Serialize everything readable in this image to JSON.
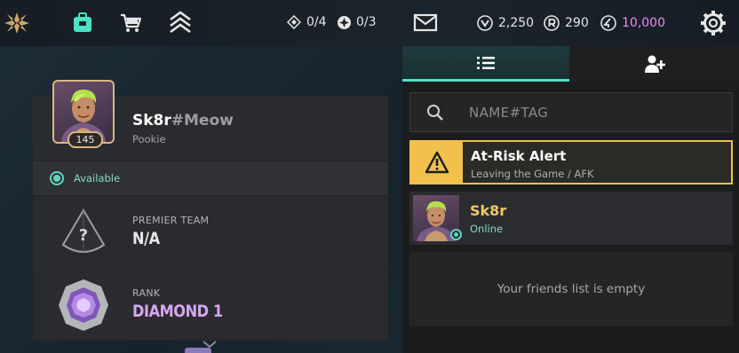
{
  "topbar": {
    "nav_icons": [
      "valorant-logo-icon",
      "collection-icon",
      "store-icon",
      "battlepass-icon"
    ],
    "counter_a": {
      "icon": "diamond-outline-icon",
      "value": "0/4"
    },
    "counter_b": {
      "icon": "star-circle-icon",
      "value": "0/3"
    },
    "mail_icon": "mail-icon",
    "kingdom_credits": {
      "icon": "kingdom-credits-icon",
      "value": "2,250"
    },
    "radianite": {
      "icon": "radianite-icon",
      "value": "290"
    },
    "valorant_points": {
      "icon": "valorant-points-icon",
      "value": "10,000"
    },
    "settings_icon": "gear-icon",
    "colors": {
      "accent_teal": "#4de0c4",
      "vp_pink": "#e98cf2"
    }
  },
  "profile": {
    "level": "145",
    "name": "Sk8r",
    "tag": "#Meow",
    "title": "Pookie",
    "status": "Available",
    "premier": {
      "label": "PREMIER TEAM",
      "value": "N/A"
    },
    "rank": {
      "label": "RANK",
      "value": "DIAMOND 1"
    }
  },
  "friends_panel": {
    "search": {
      "placeholder": "NAME#TAG",
      "value": ""
    },
    "alert": {
      "title": "At-Risk Alert",
      "subtitle": "Leaving the Game / AFK",
      "color": "#f2c14b"
    },
    "friends": [
      {
        "name": "Sk8r",
        "status": "Online"
      }
    ],
    "empty_message": "Your friends list is empty"
  }
}
